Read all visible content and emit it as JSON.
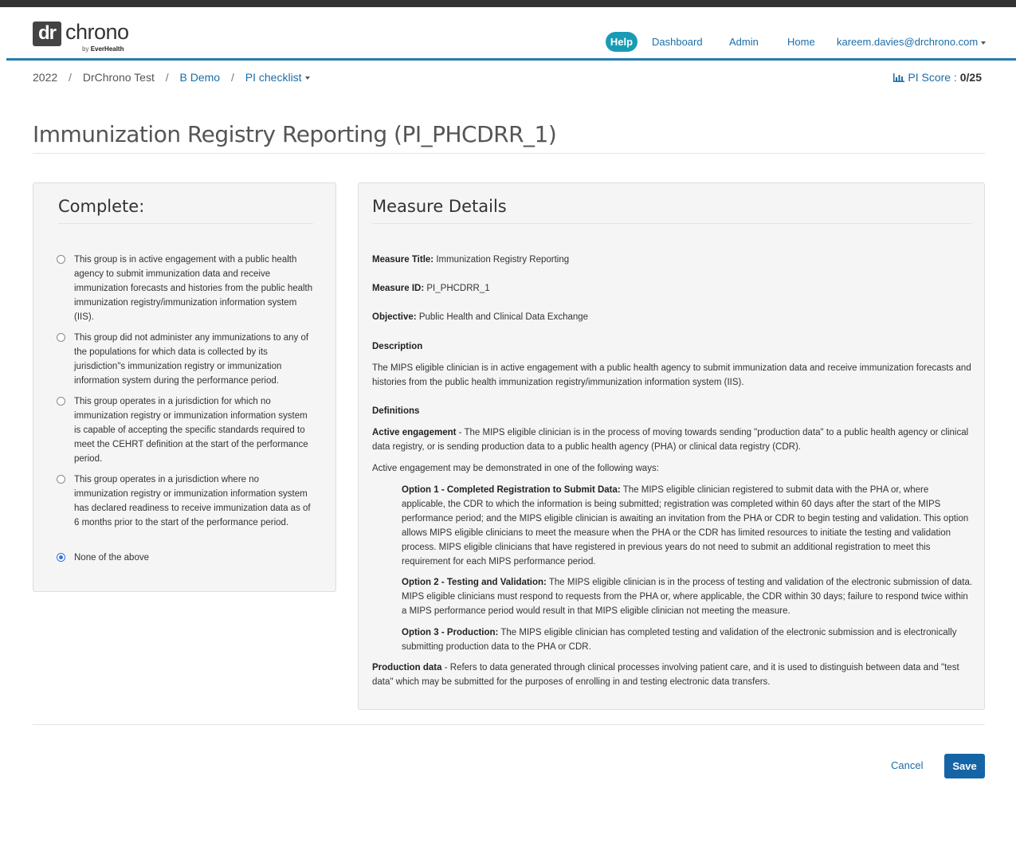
{
  "header": {
    "logo": {
      "mark": "dr",
      "word": "chrono",
      "byline_prefix": "by",
      "byline_brand": "EverHealth"
    },
    "help_label": "Help",
    "nav": {
      "dashboard": "Dashboard",
      "admin": "Admin",
      "home": "Home",
      "user_email": "kareem.davies@drchrono.com"
    }
  },
  "breadcrumb": {
    "year": "2022",
    "sep": "/",
    "practice": "DrChrono Test",
    "provider": "B Demo",
    "checklist": "PI checklist"
  },
  "pi_score": {
    "label": "PI Score",
    "sep": ":",
    "value": "0/25"
  },
  "page_title": "Immunization Registry Reporting (PI_PHCDRR_1)",
  "complete_panel": {
    "heading": "Complete:",
    "options": [
      {
        "text": "This group is in active engagement with a public health agency to submit immunization data and receive immunization forecasts and histories from the public health immunization registry/immunization information system (IIS).",
        "checked": false
      },
      {
        "text": "This group did not administer any immunizations to any of the populations for which data is collected by its jurisdiction\"s immunization registry or immunization information system during the performance period.",
        "checked": false
      },
      {
        "text": "This group operates in a jurisdiction for which no immunization registry or immunization information system is capable of accepting the specific standards required to meet the CEHRT definition at the start of the performance period.",
        "checked": false
      },
      {
        "text": "This group operates in a jurisdiction where no immunization registry or immunization information system has declared readiness to receive immunization data as of 6 months prior to the start of the performance period.",
        "checked": false
      },
      {
        "text": "None of the above",
        "checked": true
      }
    ]
  },
  "measure_details": {
    "heading": "Measure Details",
    "title_label": "Measure Title:",
    "title_value": "Immunization Registry Reporting",
    "id_label": "Measure ID:",
    "id_value": "PI_PHCDRR_1",
    "objective_label": "Objective:",
    "objective_value": "Public Health and Clinical Data Exchange",
    "description_heading": "Description",
    "description_text": "The MIPS eligible clinician is in active engagement with a public health agency to submit immunization data and receive immunization forecasts and histories from the public health immunization registry/immunization information system (IIS).",
    "definitions_heading": "Definitions",
    "active_engagement_label": "Active engagement",
    "active_engagement_text": "- The MIPS eligible clinician is in the process of moving towards sending \"production data\" to a public health agency or clinical data registry, or is sending production data to a public health agency (PHA) or clinical data registry (CDR).",
    "ways_text": "Active engagement may be demonstrated in one of the following ways:",
    "option1_label": "Option 1 - Completed Registration to Submit Data:",
    "option1_text": "The MIPS eligible clinician registered to submit data with the PHA or, where applicable, the CDR to which the information is being submitted; registration was completed within 60 days after the start of the MIPS performance period; and the MIPS eligible clinician is awaiting an invitation from the PHA or CDR to begin testing and validation. This option allows MIPS eligible clinicians to meet the measure when the PHA or the CDR has limited resources to initiate the testing and validation process. MIPS eligible clinicians that have registered in previous years do not need to submit an additional registration to meet this requirement for each MIPS performance period.",
    "option2_label": "Option 2 - Testing and Validation:",
    "option2_text": "The MIPS eligible clinician is in the process of testing and validation of the electronic submission of data. MIPS eligible clinicians must respond to requests from the PHA or, where applicable, the CDR within 30 days; failure to respond twice within a MIPS performance period would result in that MIPS eligible clinician not meeting the measure.",
    "option3_label": "Option 3 - Production:",
    "option3_text": "The MIPS eligible clinician has completed testing and validation of the electronic submission and is electronically submitting production data to the PHA or CDR.",
    "production_label": "Production data",
    "production_text": "- Refers to data generated through clinical processes involving patient care, and it is used to distinguish between data and \"test data\" which may be submitted for the purposes of enrolling in and testing electronic data transfers."
  },
  "footer": {
    "cancel_label": "Cancel",
    "save_label": "Save"
  },
  "colors": {
    "link": "#1a6ea8",
    "primary_button": "#1565a6",
    "help_badge": "#1a9bb5",
    "nav_rule": "#2a7ab0",
    "panel_bg": "#f5f5f5"
  }
}
